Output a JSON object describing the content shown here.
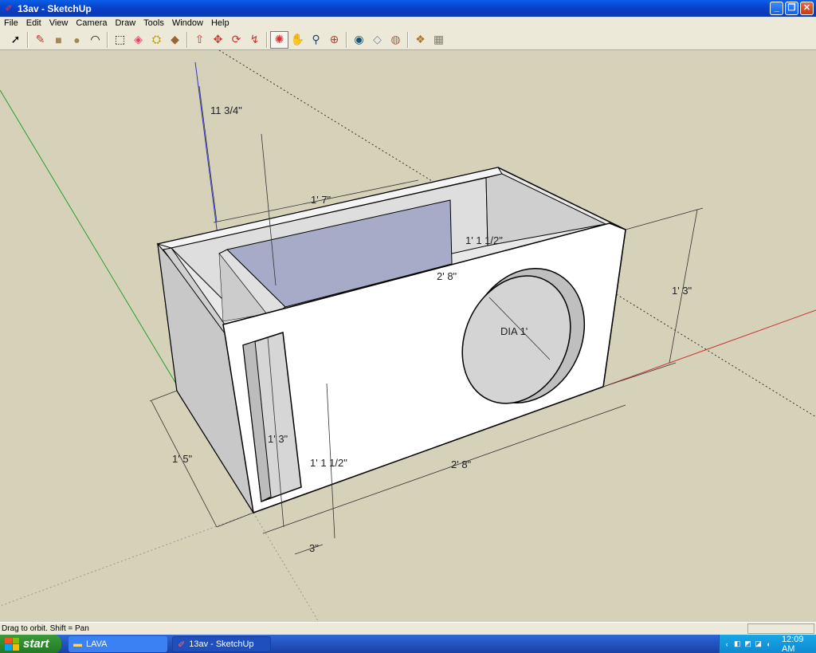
{
  "window": {
    "title": "13av - SketchUp",
    "buttons": {
      "minimize": "_",
      "restore": "❐",
      "close": "✕"
    }
  },
  "menu": [
    "File",
    "Edit",
    "View",
    "Camera",
    "Draw",
    "Tools",
    "Window",
    "Help"
  ],
  "toolbar": {
    "tools": [
      {
        "name": "select-tool",
        "glyph": "➚"
      },
      {
        "name": "pencil-tool",
        "glyph": "✎"
      },
      {
        "name": "rectangle-tool",
        "glyph": "■"
      },
      {
        "name": "circle-tool",
        "glyph": "●"
      },
      {
        "name": "arc-tool",
        "glyph": "◠"
      },
      {
        "name": "make-component-tool",
        "glyph": "⬚"
      },
      {
        "name": "eraser-tool",
        "glyph": "◈"
      },
      {
        "name": "tape-measure-tool",
        "glyph": "⛭"
      },
      {
        "name": "paint-bucket-tool",
        "glyph": "◆"
      },
      {
        "name": "push-pull-tool",
        "glyph": "⇧"
      },
      {
        "name": "move-tool",
        "glyph": "✥"
      },
      {
        "name": "rotate-tool",
        "glyph": "⟳"
      },
      {
        "name": "offset-tool",
        "glyph": "↯"
      },
      {
        "name": "orbit-tool",
        "glyph": "✺"
      },
      {
        "name": "pan-tool",
        "glyph": "✋"
      },
      {
        "name": "zoom-tool",
        "glyph": "⚲"
      },
      {
        "name": "zoom-extents-tool",
        "glyph": "⊕"
      },
      {
        "name": "get-models-tool",
        "glyph": "◉"
      },
      {
        "name": "share-model-tool",
        "glyph": "◇"
      },
      {
        "name": "google-earth-tool",
        "glyph": "◍"
      },
      {
        "name": "components-tool",
        "glyph": "❖"
      },
      {
        "name": "materials-tool",
        "glyph": "▦"
      }
    ]
  },
  "dimensions": {
    "top_offset": "11 3/4\"",
    "top_width": "1' 7\"",
    "baffle_height_inner": "1' 1 1/2\"",
    "center_length": "2' 8\"",
    "port_dia": "DIA 1'",
    "right_height": "1' 3\"",
    "left_depth": "1' 5\"",
    "port_height": "1' 3\"",
    "port_inner_height": "1' 1 1/2\"",
    "bottom_length": "2' 8\"",
    "port_width": "3\""
  },
  "status": {
    "hint": "Drag to orbit.  Shift = Pan"
  },
  "taskbar": {
    "start_label": "start",
    "tasks": [
      "LAVA",
      "13av - SketchUp"
    ],
    "clock": "12:09 AM"
  },
  "colors": {
    "viewport_bg": "#d5d2b9",
    "box_face": "#ffffff",
    "box_shade": "#c9c9c9",
    "interior_divider": "#a8abc8",
    "axis_green": "#2e9a2e",
    "axis_red": "#cc3333",
    "axis_blue": "#3333cc"
  }
}
